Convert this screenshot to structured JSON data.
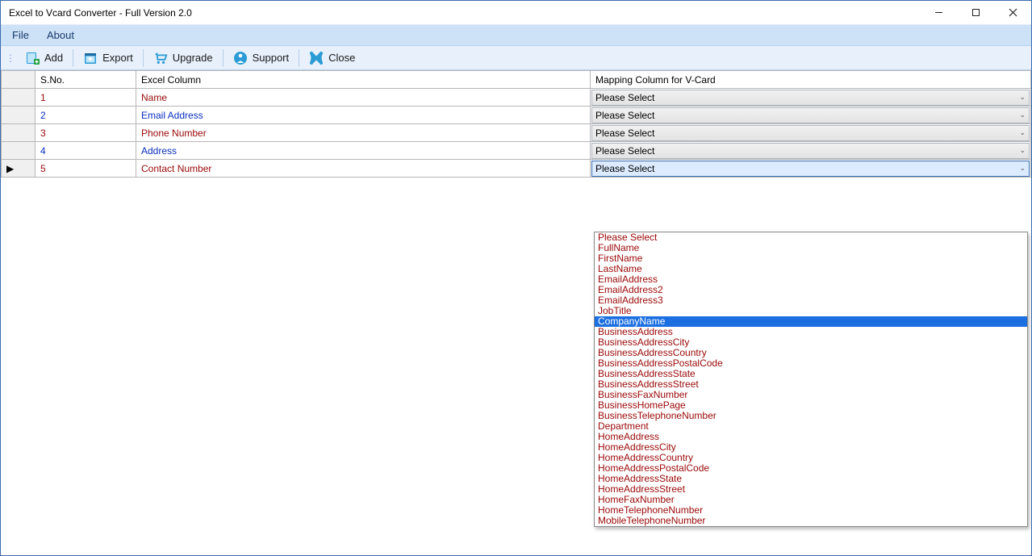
{
  "window": {
    "title": "Excel to Vcard Converter - Full Version 2.0"
  },
  "menu": {
    "file": "File",
    "about": "About"
  },
  "toolbar": {
    "add": "Add",
    "export": "Export",
    "upgrade": "Upgrade",
    "support": "Support",
    "close": "Close"
  },
  "grid": {
    "headers": {
      "sno": "S.No.",
      "excel": "Excel Column",
      "map": "Mapping Column for V-Card"
    },
    "combo_placeholder": "Please Select",
    "rows": [
      {
        "sno": "1",
        "excel": "Name",
        "color": "red",
        "selected": "Please Select"
      },
      {
        "sno": "2",
        "excel": "Email Address",
        "color": "blue",
        "selected": "Please Select"
      },
      {
        "sno": "3",
        "excel": "Phone Number",
        "color": "red",
        "selected": "Please Select"
      },
      {
        "sno": "4",
        "excel": "Address",
        "color": "blue",
        "selected": "Please Select"
      },
      {
        "sno": "5",
        "excel": "Contact Number",
        "color": "red",
        "selected": "Please Select"
      }
    ]
  },
  "dropdown": {
    "highlight_index": 8,
    "options": [
      "Please Select",
      "FullName",
      "FirstName",
      "LastName",
      "EmailAddress",
      "EmailAddress2",
      "EmailAddress3",
      "JobTitle",
      "CompanyName",
      "BusinessAddress",
      "BusinessAddressCity",
      "BusinessAddressCountry",
      "BusinessAddressPostalCode",
      "BusinessAddressState",
      "BusinessAddressStreet",
      "BusinessFaxNumber",
      "BusinessHomePage",
      "BusinessTelephoneNumber",
      "Department",
      "HomeAddress",
      "HomeAddressCity",
      "HomeAddressCountry",
      "HomeAddressPostalCode",
      "HomeAddressState",
      "HomeAddressStreet",
      "HomeFaxNumber",
      "HomeTelephoneNumber",
      "MobileTelephoneNumber"
    ]
  }
}
